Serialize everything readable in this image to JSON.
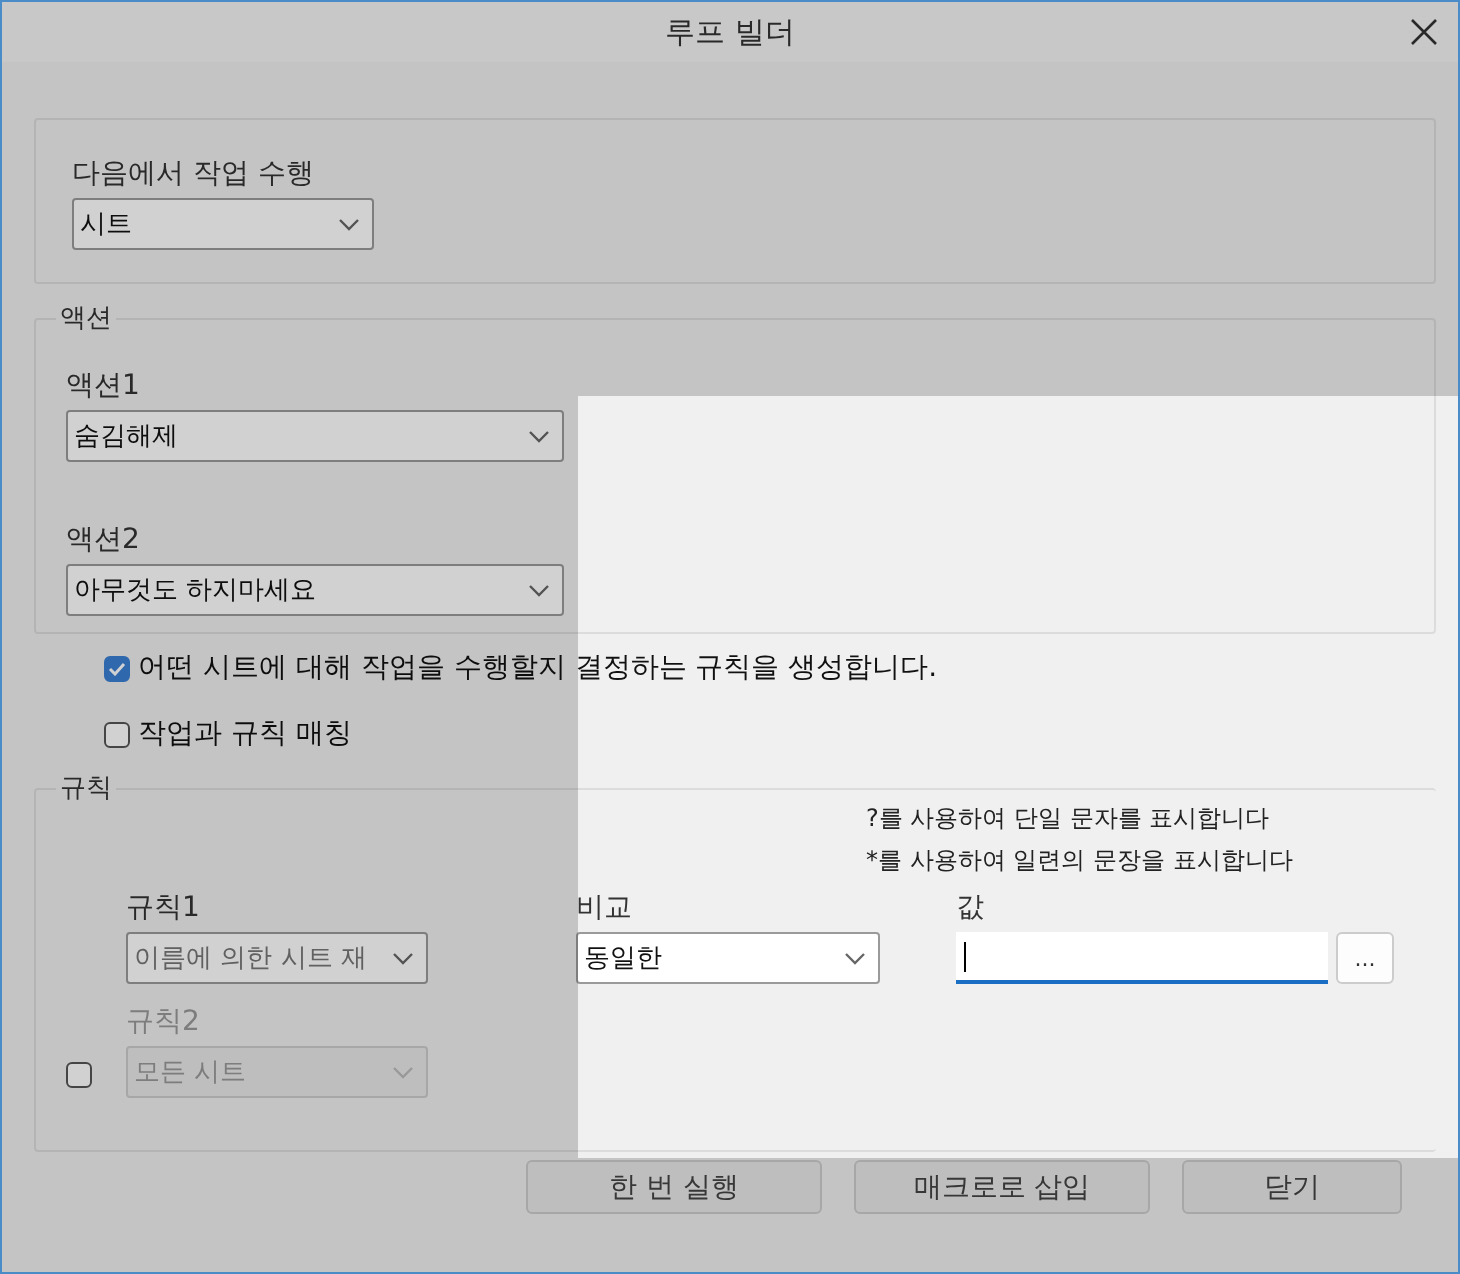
{
  "window": {
    "title": "루프 빌더"
  },
  "perform_on": {
    "label": "다음에서 작업 수행",
    "value": "시트"
  },
  "actions": {
    "title": "액션",
    "items": [
      {
        "label": "액션1",
        "value": "숨김해제"
      },
      {
        "label": "액션2",
        "value": "아무것도 하지마세요"
      }
    ]
  },
  "options": [
    {
      "label": "어떤 시트에 대해 작업을 수행할지 결정하는 규칙을 생성합니다.",
      "checked": true
    },
    {
      "label": "작업과 규칙 매칭",
      "checked": false
    }
  ],
  "rules": {
    "title": "규칙",
    "hints": [
      "?를 사용하여 단일 문자를 표시합니다",
      "*를 사용하여 일련의 문장을 표시합니다"
    ],
    "items": [
      {
        "kind": "fixed",
        "label": "규칙1",
        "value": "이름에 의한 시트 재",
        "disabled": false
      },
      {
        "kind": "optional",
        "label": "규칙2",
        "value": "모든 시트",
        "disabled": true,
        "checked": false
      }
    ],
    "compare": {
      "label": "비교",
      "value": "동일한"
    },
    "value_field": {
      "label": "값",
      "focused": true,
      "browse": "..."
    }
  },
  "buttons": [
    "한 번 실행",
    "매크로로 삽입",
    "닫기"
  ]
}
